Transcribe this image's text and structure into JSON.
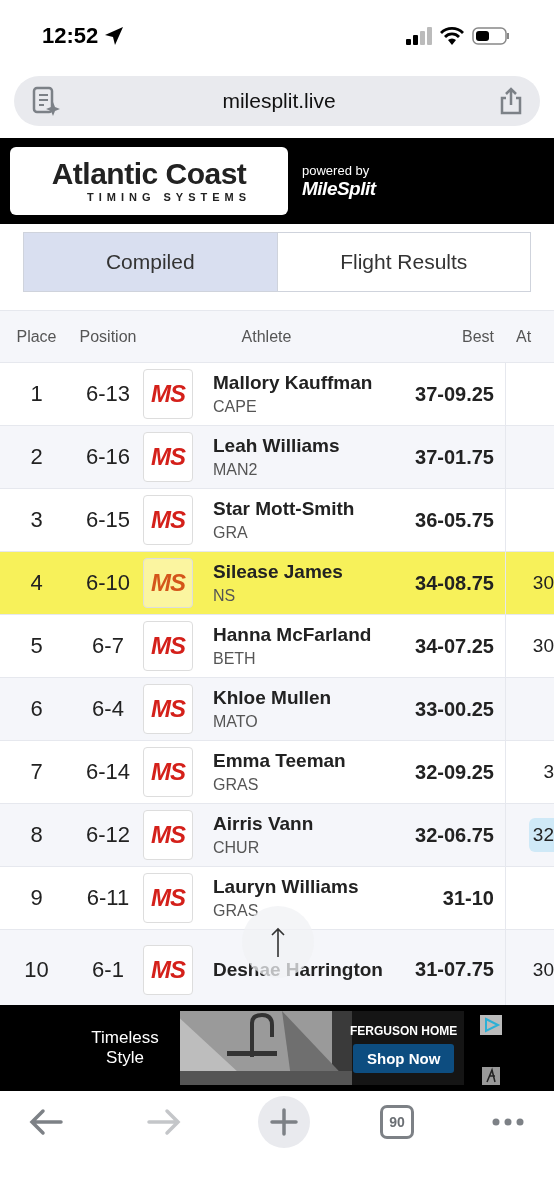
{
  "status_bar": {
    "time": "12:52"
  },
  "address_bar": {
    "url": "milesplit.live"
  },
  "banner": {
    "logo_title": "Atlantic Coast",
    "logo_subtitle": "TIMING SYSTEMS",
    "powered_by": "powered by",
    "brand": "MileSplit"
  },
  "tabs": [
    {
      "label": "Compiled",
      "selected": true
    },
    {
      "label": "Flight Results",
      "selected": false
    }
  ],
  "table": {
    "columns": [
      "Place",
      "Position",
      "Athlete",
      "Best",
      "At"
    ],
    "rows": [
      {
        "place": "1",
        "position": "6-13",
        "logo": "MS",
        "athlete": "Mallory Kauffman",
        "team": "CAPE",
        "best": "37-09.25",
        "highlighted": false
      },
      {
        "place": "2",
        "position": "6-16",
        "logo": "MS",
        "athlete": "Leah Williams",
        "team": "MAN2",
        "best": "37-01.75",
        "highlighted": false
      },
      {
        "place": "3",
        "position": "6-15",
        "logo": "MS",
        "athlete": "Star Mott-Smith",
        "team": "GRA",
        "best": "36-05.75",
        "highlighted": false
      },
      {
        "place": "4",
        "position": "6-10",
        "logo": "MS",
        "athlete": "Silease James",
        "team": "NS",
        "best": "34-08.75",
        "highlighted": true,
        "column_5": {
          "text": "30",
          "marked": false
        }
      },
      {
        "place": "5",
        "position": "6-7",
        "logo": "MS",
        "athlete": "Hanna McFarland",
        "team": "BETH",
        "best": "34-07.25",
        "highlighted": false,
        "column_5": {
          "text": "30",
          "marked": false
        }
      },
      {
        "place": "6",
        "position": "6-4",
        "logo": "MS",
        "athlete": "Khloe Mullen",
        "team": "MATO",
        "best": "33-00.25",
        "highlighted": false
      },
      {
        "place": "7",
        "position": "6-14",
        "logo": "MS",
        "athlete": "Emma Teeman",
        "team": "GRAS",
        "best": "32-09.25",
        "highlighted": false,
        "column_5": {
          "text": "3",
          "marked": false
        }
      },
      {
        "place": "8",
        "position": "6-12",
        "logo": "MS",
        "athlete": "Airris Vann",
        "team": "CHUR",
        "best": "32-06.75",
        "highlighted": false,
        "column_5": {
          "text": "32",
          "marked": true
        }
      },
      {
        "place": "9",
        "position": "6-11",
        "logo": "MS",
        "athlete": "Lauryn Williams",
        "team": "GRAS",
        "best": "31-10",
        "highlighted": false
      },
      {
        "place": "10",
        "position": "6-1",
        "logo": "MS",
        "athlete": "Deshae Harrington",
        "best": "31-07.75",
        "highlighted": false,
        "column_5": {
          "text": "30",
          "marked": false
        }
      }
    ]
  },
  "ad": {
    "headline": "Timeless Style",
    "brand": "FERGUSON HOME",
    "button": "Shop Now"
  },
  "toolbar": {
    "tab_count": "90"
  }
}
